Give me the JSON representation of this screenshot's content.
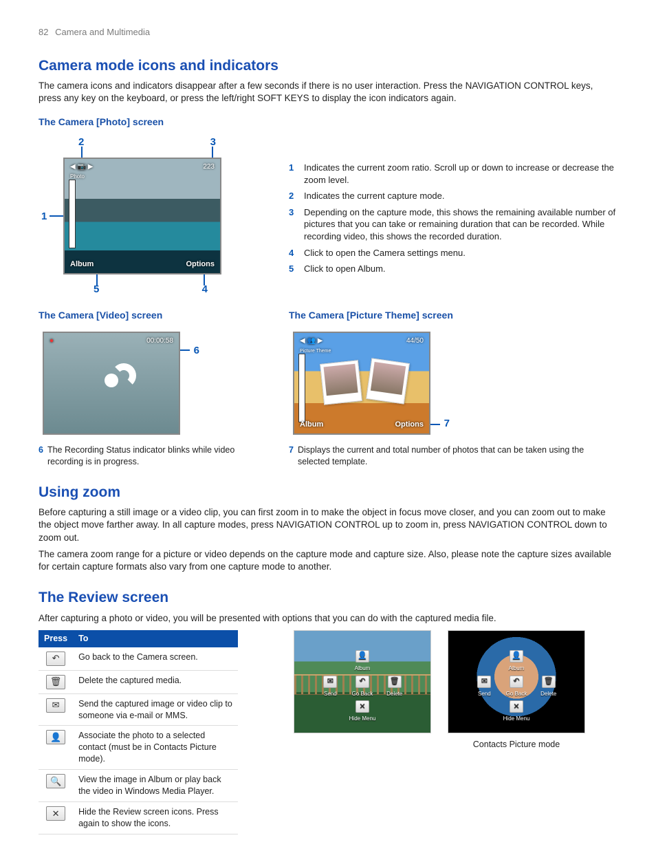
{
  "header": {
    "page_num": "82",
    "chapter": "Camera and Multimedia"
  },
  "sec1": {
    "title": "Camera mode icons and indicators",
    "intro": "The camera icons and indicators disappear after a few seconds if there is no user interaction. Press the NAVIGATION CONTROL keys, press any key on the keyboard, or press the left/right SOFT KEYS to display the icon indicators again."
  },
  "photo": {
    "heading": "The Camera [Photo] screen",
    "callout_nums": {
      "n1": "1",
      "n2": "2",
      "n3": "3",
      "n4": "4",
      "n5": "5"
    },
    "ui": {
      "topleft": "◀ 📷 ▶",
      "topleft_label": "Photo",
      "topright": "223",
      "bl": "Album",
      "br": "Options"
    },
    "items": [
      {
        "n": "1",
        "t": "Indicates the current zoom ratio. Scroll up or down to increase or decrease the zoom level."
      },
      {
        "n": "2",
        "t": "Indicates the current capture mode."
      },
      {
        "n": "3",
        "t": "Depending on the capture mode, this shows the remaining available number of pictures that you can take or remaining duration that can be recorded. While recording video, this shows the recorded duration."
      },
      {
        "n": "4",
        "t": "Click to open the Camera settings menu."
      },
      {
        "n": "5",
        "t": "Click to open Album."
      }
    ]
  },
  "video": {
    "heading": "The Camera [Video] screen",
    "callout_num": "6",
    "ui": {
      "timer": "00:00:58"
    },
    "note": {
      "n": "6",
      "t": "The Recording Status indicator blinks while video recording is in progress."
    }
  },
  "theme": {
    "heading": "The Camera [Picture Theme] screen",
    "callout_num": "7",
    "ui": {
      "topleft": "◀ 👥 ▶",
      "topleft_label": "Picture Theme",
      "topright": "44/50",
      "bl": "Album",
      "br": "Options"
    },
    "note": {
      "n": "7",
      "t": "Displays the current and total number of photos that can be taken using the selected template."
    }
  },
  "zoom": {
    "title": "Using zoom",
    "p1": "Before capturing a still image or a video clip, you can first zoom in to make the object in focus move closer, and you can zoom out to make the object move farther away. In all capture modes, press NAVIGATION CONTROL up to zoom in, press NAVIGATION CONTROL down to zoom out.",
    "p2": "The camera zoom range for a picture or video depends on the capture mode and capture size. Also, please note the capture sizes available for certain capture formats also vary from one capture mode to another."
  },
  "review": {
    "title": "The Review screen",
    "intro": "After capturing a photo or video, you will be presented with options that you can do with the captured media file.",
    "th_press": "Press",
    "th_to": "To",
    "rows": [
      {
        "icon": "↶",
        "t": "Go back to the Camera screen."
      },
      {
        "icon": "🗑",
        "t": "Delete the captured media."
      },
      {
        "icon": "✉",
        "t": "Send the captured image or video clip to someone via e-mail or MMS."
      },
      {
        "icon": "👤",
        "t": "Associate the photo to a selected contact (must be in Contacts Picture mode)."
      },
      {
        "icon": "🔍",
        "t": "View the image in Album or play back the video in Windows Media Player."
      },
      {
        "icon": "✕",
        "t": "Hide the Review screen icons. Press again to show the icons."
      }
    ],
    "menu": {
      "album": "Album",
      "send": "Send",
      "back": "Go Back",
      "delete": "Delete",
      "hide": "Hide Menu"
    },
    "caption": "Contacts Picture mode"
  }
}
